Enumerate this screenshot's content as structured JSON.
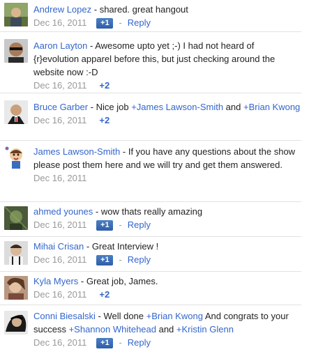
{
  "comments": [
    {
      "author": "Andrew Lopez",
      "segments": [
        "shared. great hangout"
      ],
      "date": "",
      "action": "plusone_reply"
    },
    {
      "author": "Aaron Layton",
      "segments": [
        "Awesome upto yet ;-) I had not heard of {r}evolution apparel before this, but just checking around the website now :-D"
      ],
      "date": "Dec 16, 2011",
      "action": "plus2"
    },
    {
      "author": "Bruce Garber",
      "segments": [
        "Nice job ",
        "+James Lawson-Smith",
        " and ",
        "+Brian Kwong"
      ],
      "date": "Dec 16, 2011",
      "action": "plus2"
    },
    {
      "author": "James Lawson-Smith",
      "segments": [
        "If you have any questions about the show please post them here and we will try and get them answered."
      ],
      "date": "Dec 16, 2011",
      "action": "none"
    },
    {
      "author": "ahmed younes",
      "segments": [
        "wow thats really amazing"
      ],
      "date": "Dec 16, 2011",
      "action": "plusone_reply"
    },
    {
      "author": "Mihai Crisan",
      "segments": [
        "Great Interview !"
      ],
      "date": "Dec 16, 2011",
      "action": "plusone_reply"
    },
    {
      "author": "Kyla Myers",
      "segments": [
        "Great job, James."
      ],
      "date": "Dec 16, 2011",
      "action": "plus2"
    },
    {
      "author": "Conni Biesalski",
      "segments": [
        "Well done ",
        "+Brian Kwong",
        " And congrats to your success ",
        "+Shannon Whitehead",
        " and ",
        "+Kristin Glenn"
      ],
      "date": "Dec 16, 2011",
      "action": "plusone_reply"
    }
  ],
  "first_row_date": "Dec 16, 2011",
  "labels": {
    "separator": " - ",
    "plusone": "+1",
    "dash": "-",
    "reply": "Reply",
    "plus2": "+2"
  },
  "colors": {
    "link": "#3366cc",
    "meta": "#999999",
    "plusone_bg": "#3568b3",
    "divider": "#e2e2e2"
  },
  "icons": {
    "plusone": "plus-one-button"
  }
}
